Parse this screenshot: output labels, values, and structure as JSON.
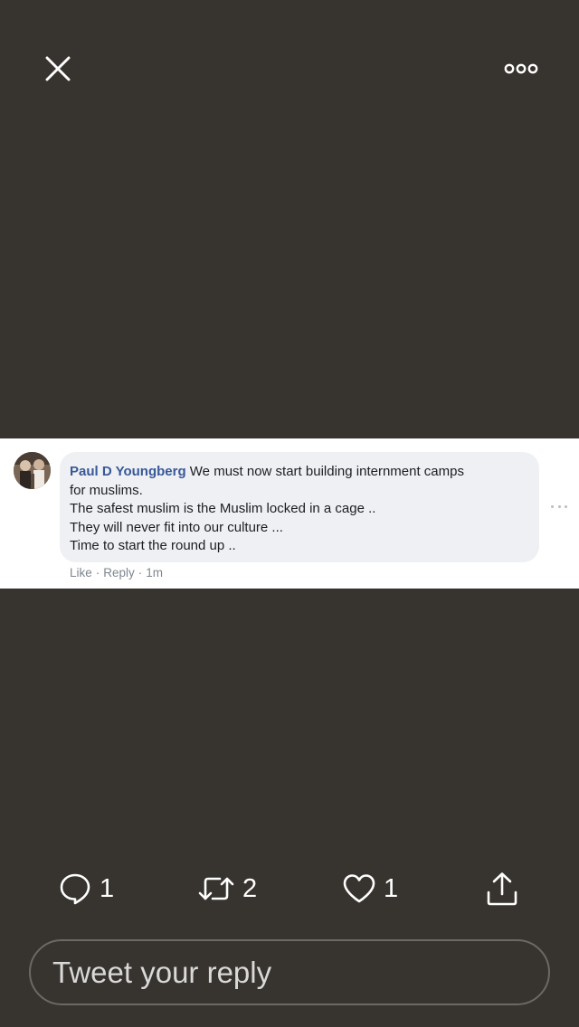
{
  "header": {
    "close_icon": "close-icon",
    "more_icon": "more-dots-icon"
  },
  "media": {
    "comment": {
      "author": "Paul D Youngberg",
      "lines": [
        "We must now start building internment camps",
        "for muslims.",
        "The safest muslim is the Muslim locked in a cage ..",
        "They will never fit into our culture ...",
        "Time to start the round up .."
      ],
      "like": "Like",
      "reply": "Reply",
      "time": "1m",
      "separator": "·"
    }
  },
  "actions": {
    "reply": {
      "icon": "comment-icon",
      "count": "1"
    },
    "retweet": {
      "icon": "retweet-icon",
      "count": "2"
    },
    "like": {
      "icon": "heart-icon",
      "count": "1"
    },
    "share": {
      "icon": "share-icon"
    }
  },
  "composer": {
    "placeholder": "Tweet your reply"
  },
  "colors": {
    "background": "#37332e",
    "author_link": "#385898",
    "bubble": "#eef0f3"
  }
}
